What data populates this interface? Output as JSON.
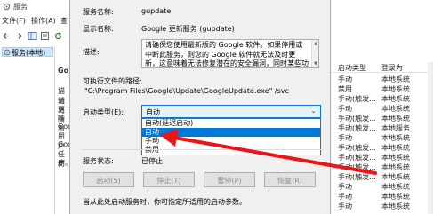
{
  "background_window": {
    "title": "服务",
    "menu": [
      "文件(F)",
      "操作(A)",
      "查"
    ],
    "tree_item": "服务(本地)",
    "left_pane_fragments": [
      "Go",
      "描述",
      "请将",
      "更新",
      "味着",
      "Goo",
      "用户",
      "Goo",
      "任何",
      "序。"
    ],
    "columns": {
      "startup_type": "启动类型",
      "logon_as": "登录为"
    },
    "rows": [
      {
        "startup": "手动",
        "logon": "本地系统"
      },
      {
        "startup": "禁用",
        "logon": "本地系统"
      },
      {
        "startup": "手动(触发...",
        "logon": "本地系统"
      },
      {
        "startup": "手动",
        "logon": "本地系统"
      },
      {
        "startup": "手动(触发...",
        "logon": "本地系统"
      },
      {
        "startup": "手动(触发...",
        "logon": "本地服务"
      },
      {
        "startup": "手动",
        "logon": "本地系统"
      },
      {
        "startup": "手动(触发...",
        "logon": "本地系统"
      },
      {
        "startup": "手动(触发...",
        "logon": "本地系统"
      },
      {
        "startup": "手动(触发...",
        "logon": "本地系统"
      },
      {
        "startup": "手动(触发...",
        "logon": "本地系统"
      },
      {
        "startup": "手动",
        "logon": "本地系统"
      },
      {
        "startup": "手动",
        "logon": "本地系统"
      },
      {
        "startup": "手动",
        "logon": "本地系统"
      }
    ]
  },
  "dialog": {
    "service_name_label": "服务名称:",
    "service_name_value": "gupdate",
    "display_name_label": "显示名称:",
    "display_name_value": "Google 更新服务 (gupdate)",
    "description_label": "描述:",
    "description_value": "请确保您使用最新版的 Google 软件。如果停用或中断此服务，则您的 Google 软件就无法及时更新，这意味着无法修复潜在的安全漏洞，同时某些功能也无法正常运行。",
    "exe_path_label": "可执行文件的路径:",
    "exe_path_value": "\"C:\\Program Files\\Google\\Update\\GoogleUpdate.exe\" /svc",
    "startup_type_label": "启动类型(E):",
    "startup_type_selected": "自动",
    "startup_options": [
      "自动(延迟启动)",
      "自动",
      "手动",
      "禁用"
    ],
    "highlighted_option": "自动",
    "service_status_label": "服务状态:",
    "service_status_value": "已停止",
    "buttons": {
      "start": "启动(S)",
      "stop": "停止(T)",
      "pause": "暂停(P)",
      "resume": "恢复(R)"
    },
    "hint": "当从此处启动服务时，你可指定所适用的启动参数。"
  },
  "colors": {
    "highlight": "#0078d7",
    "annotation_arrow": "#e8151b"
  }
}
